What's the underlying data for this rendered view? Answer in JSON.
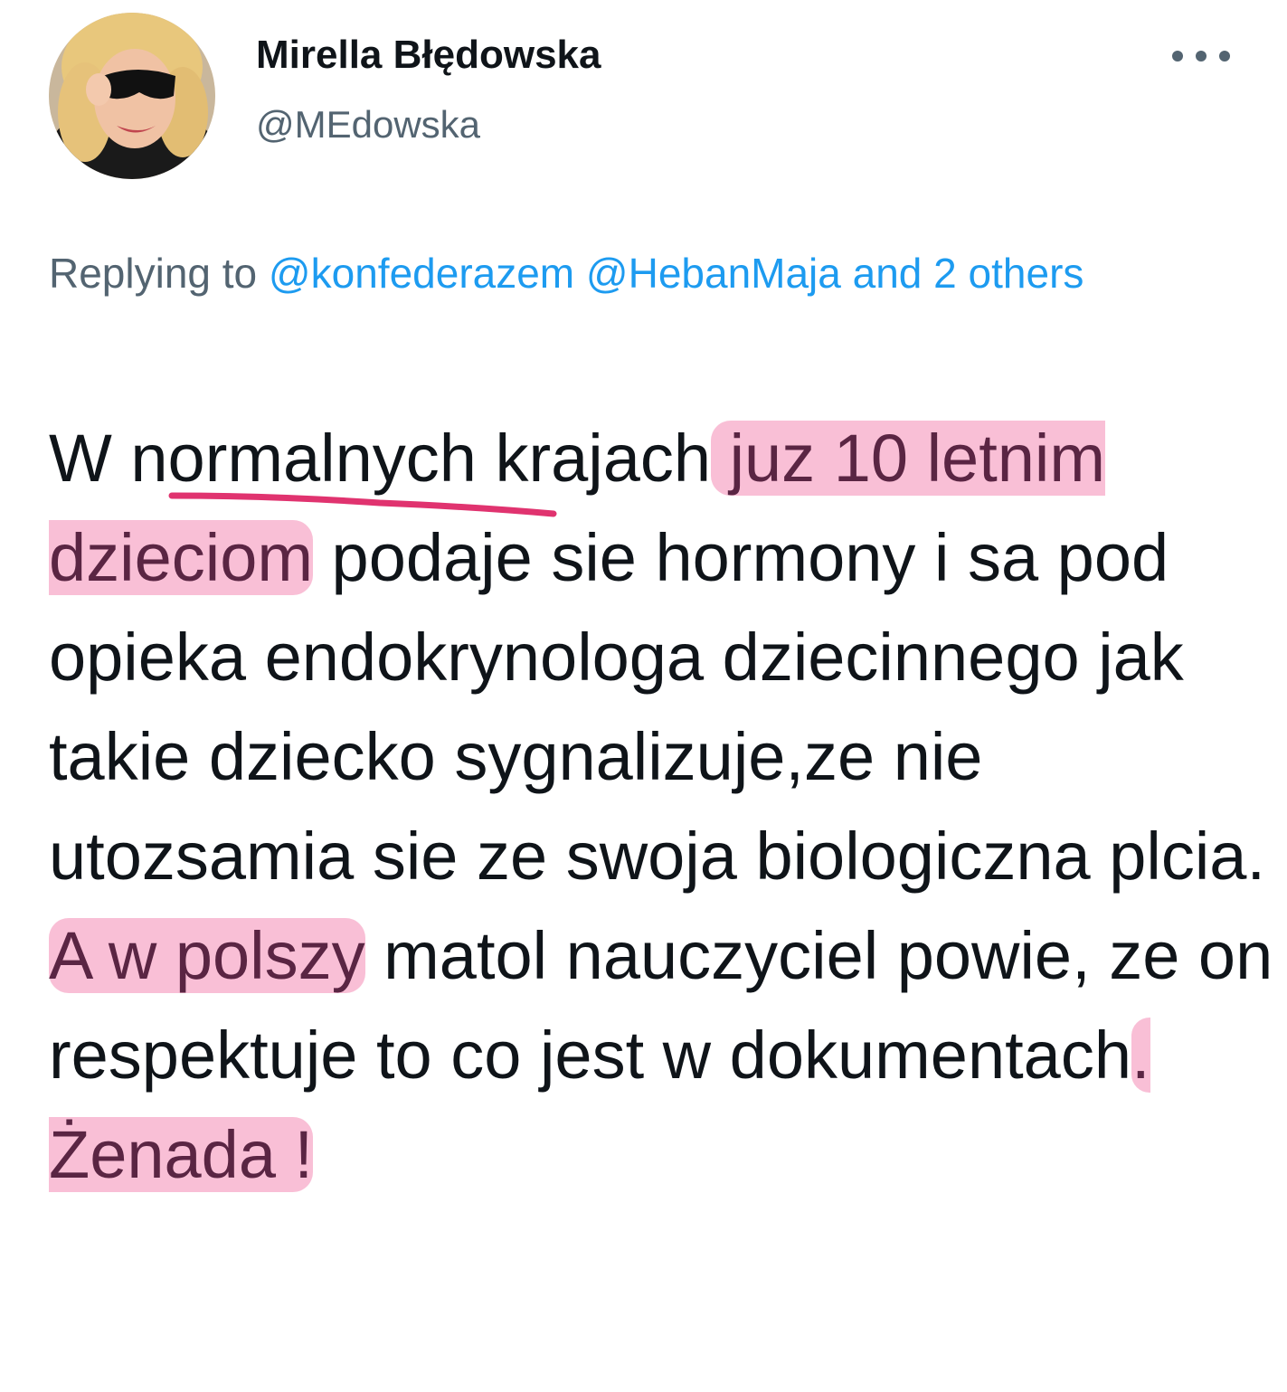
{
  "author": {
    "name": "Mirella Błędowska",
    "handle": "@MEdowska"
  },
  "reply": {
    "prefix": "Replying to",
    "mention_1": "@konfederazem",
    "mention_2": "@HebanMaja",
    "others": "and 2 others"
  },
  "tweet": {
    "seg_1": "W ",
    "seg_normalnych": "normalnych",
    "seg_2": " krajach",
    "hl_1": " juz 10 letnim dzieciom",
    "seg_3": " podaje sie hormony i sa pod opieka endokrynologa dziecinnego jak takie dziecko sygnalizuje,ze nie utozsamia sie ze swoja biologiczna plcia.  ",
    "hl_2": "A w polszy",
    "seg_4": " matol nauczyciel powie, ze on respektuje to co jest w dokumentach",
    "hl_3": ". Żenada !"
  },
  "icons": {
    "more": "more-horizontal-icon"
  },
  "colors": {
    "link": "#1d9bf0",
    "secondary_text": "#536471",
    "highlight": "#f48ab4",
    "underline": "#e0336f"
  }
}
